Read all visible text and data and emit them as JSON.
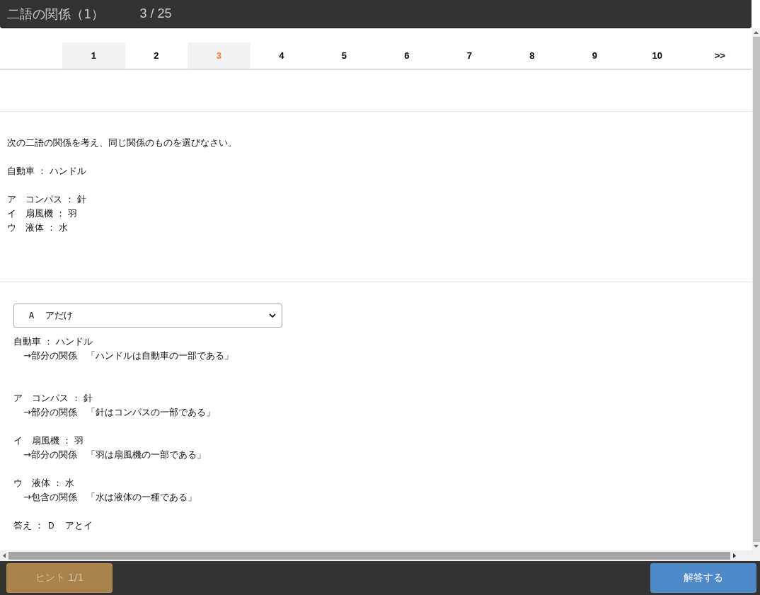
{
  "header": {
    "title": "二語の関係（1）",
    "progress": "3 / 25"
  },
  "pagination": [
    {
      "label": "1",
      "visited": true,
      "selected": false
    },
    {
      "label": "2",
      "visited": false,
      "selected": false
    },
    {
      "label": "3",
      "visited": true,
      "selected": true
    },
    {
      "label": "4",
      "visited": false,
      "selected": false
    },
    {
      "label": "5",
      "visited": false,
      "selected": false
    },
    {
      "label": "6",
      "visited": false,
      "selected": false
    },
    {
      "label": "7",
      "visited": false,
      "selected": false
    },
    {
      "label": "8",
      "visited": false,
      "selected": false
    },
    {
      "label": "9",
      "visited": false,
      "selected": false
    },
    {
      "label": "10",
      "visited": false,
      "selected": false
    },
    {
      "label": ">>",
      "visited": false,
      "selected": false
    }
  ],
  "question": {
    "instruction": "次の二語の関係を考え、同じ関係のものを選びなさい。",
    "pair": "自動車 ： ハンドル",
    "options": [
      "ア　コンパス ： 針",
      "イ　扇風機 ： 羽",
      "ウ　液体 ： 水"
    ]
  },
  "answer_select": {
    "value": "Ａ　アだけ"
  },
  "explanation": [
    {
      "pair": "自動車 ： ハンドル",
      "relation": "→部分の関係　「ハンドルは自動車の一部である」"
    },
    {
      "pair": "ア　コンパス ： 針",
      "relation": "→部分の関係　「針はコンパスの一部である」"
    },
    {
      "pair": "イ　扇風機 ： 羽",
      "relation": "→部分の関係　「羽は扇風機の一部である」"
    },
    {
      "pair": "ウ　液体 ： 水",
      "relation": "→包含の関係　「水は液体の一種である」"
    }
  ],
  "answer": "答え ： Ｄ　アとイ",
  "footer": {
    "hint_button": {
      "label": "ヒント 1/1",
      "disabled": true
    },
    "submit_button": {
      "label": "解答する"
    }
  }
}
